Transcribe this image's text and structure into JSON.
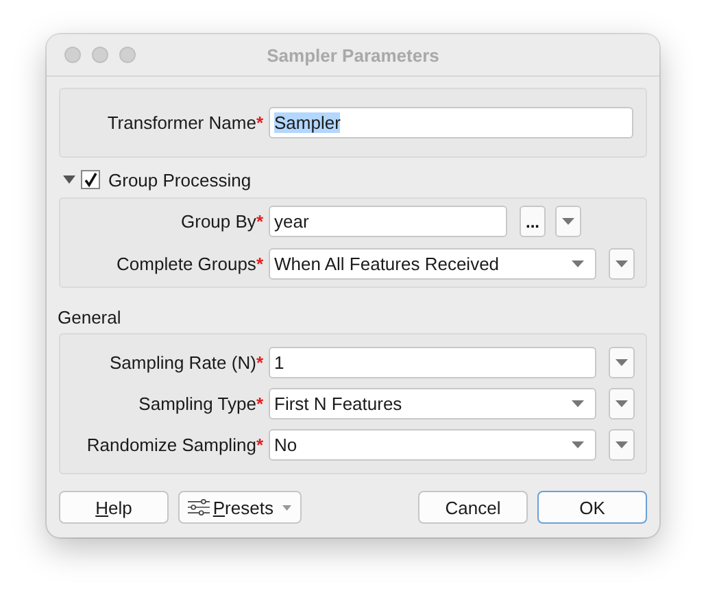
{
  "window": {
    "title": "Sampler Parameters"
  },
  "name_field": {
    "label": "Transformer Name",
    "mark": "*",
    "value": "Sampler",
    "text_selected": true
  },
  "group_processing": {
    "label": "Group Processing",
    "expanded": true,
    "checked": true,
    "fields": [
      {
        "kind": "text",
        "label": "Group By",
        "mark": "*",
        "value": "year",
        "browse": "..."
      },
      {
        "kind": "combo",
        "label": "Complete Groups",
        "mark": "*",
        "value": "When All Features Received"
      }
    ]
  },
  "general": {
    "label": "General",
    "fields": [
      {
        "kind": "text",
        "label": "Sampling Rate (N)",
        "mark": "*",
        "value": "1"
      },
      {
        "kind": "combo",
        "label": "Sampling Type",
        "mark": "*",
        "value": "First N Features"
      },
      {
        "kind": "combo",
        "label": "Randomize Sampling",
        "mark": "*",
        "value": "No"
      }
    ]
  },
  "buttons": [
    {
      "kind": "plain",
      "mnemonic": "H",
      "rest": "elp",
      "default": false
    },
    {
      "kind": "presets",
      "mnemonic": "P",
      "rest": "resets",
      "default": false
    },
    {
      "kind": "plain",
      "rest": "Cancel",
      "default": false
    },
    {
      "kind": "plain",
      "rest": "OK",
      "default": true
    }
  ]
}
